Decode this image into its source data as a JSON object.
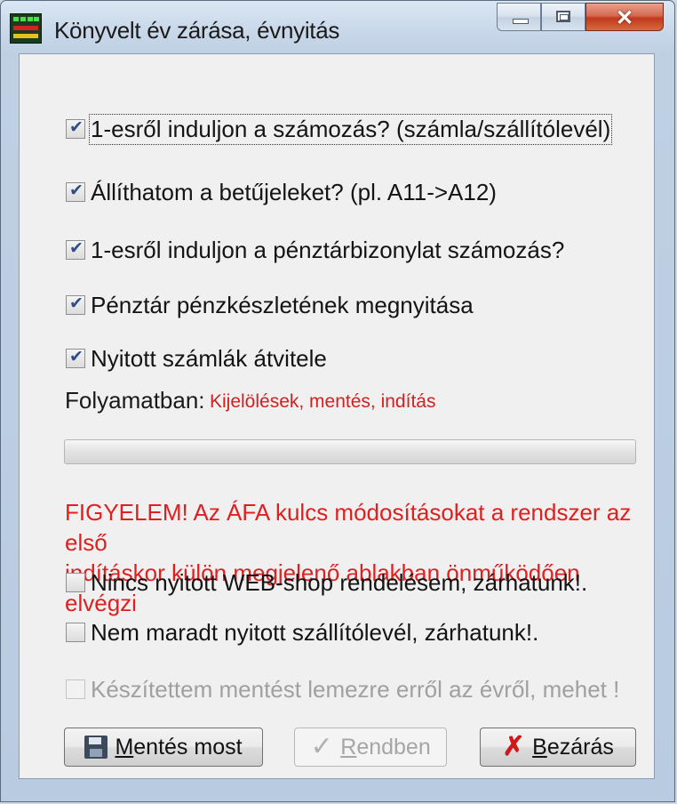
{
  "window": {
    "title": "Könyvelt év zárása, évnyitás",
    "controls": {
      "minimize": "minimize",
      "maximize": "maximize",
      "close": "✕"
    }
  },
  "options": [
    {
      "label": "1-esről induljon a számozás? (számla/szállítólevél)",
      "checked": true
    },
    {
      "label": "Állíthatom a betűjeleket? (pl. A11->A12)",
      "checked": true
    },
    {
      "label": "1-esről induljon a pénztárbizonylat számozás?",
      "checked": true
    },
    {
      "label": "Pénztár pénzkészletének megnyitása",
      "checked": true
    },
    {
      "label": "Nyitott számlák átvitele",
      "checked": true
    }
  ],
  "progress": {
    "label": "Folyamatban:",
    "status": "Kijelölések, mentés, indítás",
    "value": 0
  },
  "warning": {
    "line1": "FIGYELEM! Az ÁFA kulcs módosításokat a rendszer az első",
    "line2": "indításkor külön megjelenő ablakban önműködően elvégzi"
  },
  "confirmations": [
    {
      "label": "Nincs nyitott WEB-shop rendelésem, zárhatunk!.",
      "checked": false
    },
    {
      "label": "Nem maradt nyitott szállítólevél, zárhatunk!.",
      "checked": false
    },
    {
      "label": "Készítettem mentést lemezre erről az évről, mehet !",
      "checked": false,
      "disabled": true
    }
  ],
  "buttons": {
    "save": {
      "mnemonic": "M",
      "rest": "entés most"
    },
    "ok": {
      "mnemonic": "R",
      "rest": "endben",
      "disabled": true
    },
    "close": {
      "mnemonic": "B",
      "rest": "ezárás"
    }
  },
  "colors": {
    "accent_red": "#e02020",
    "status_red": "#d42020",
    "check_blue": "#2d4f86"
  }
}
